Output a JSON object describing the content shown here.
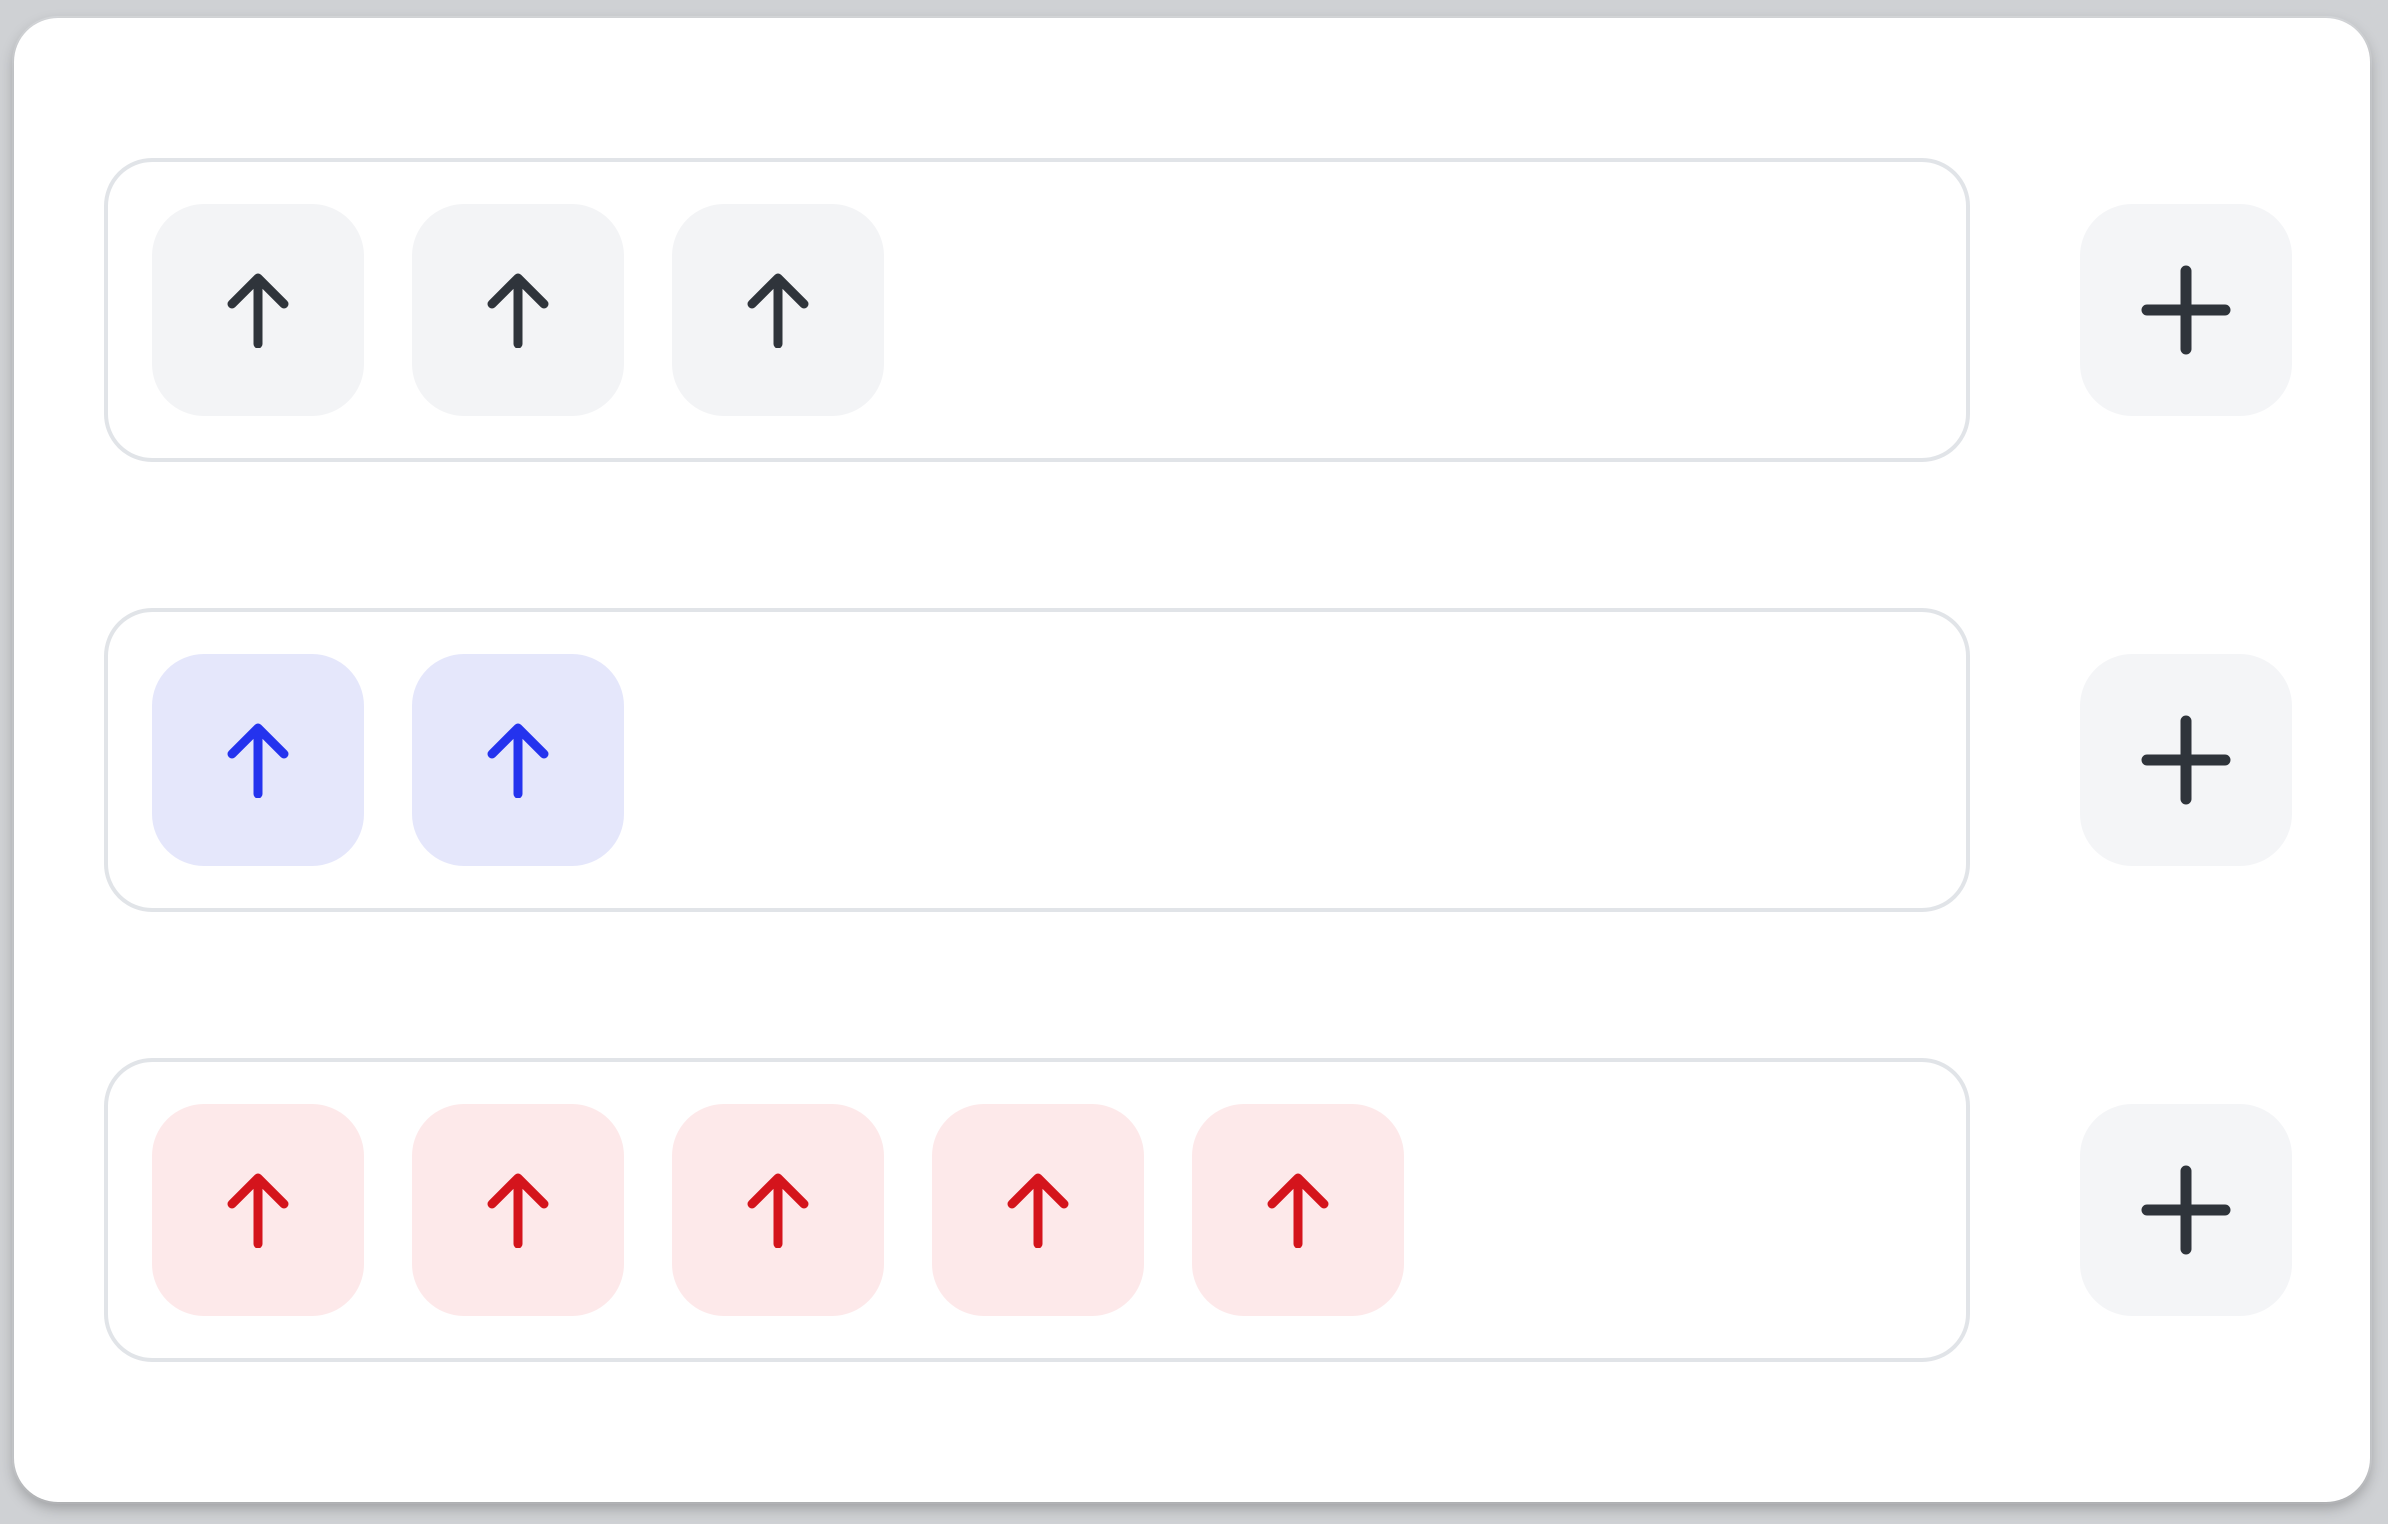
{
  "rows": [
    {
      "name": "gray",
      "count": 3,
      "chip_bg": "#f3f4f6",
      "icon_color": "#2f343b",
      "icon": "arrow-up-icon"
    },
    {
      "name": "blue",
      "count": 2,
      "chip_bg": "#e5e7fb",
      "icon_color": "#2433ee",
      "icon": "arrow-up-icon"
    },
    {
      "name": "red",
      "count": 5,
      "chip_bg": "#fde9ea",
      "icon_color": "#d4141c",
      "icon": "arrow-up-icon"
    }
  ],
  "add_button": {
    "icon": "plus-icon",
    "bg": "#f4f5f7",
    "icon_color": "#2f343b"
  }
}
